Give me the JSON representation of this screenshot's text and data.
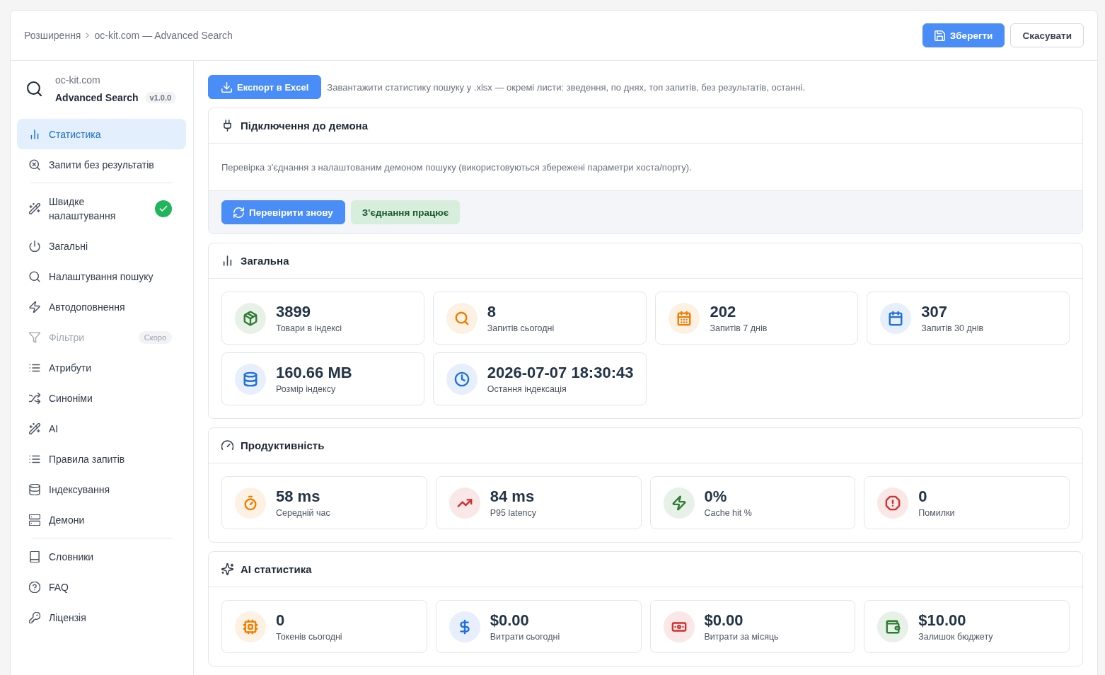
{
  "header": {
    "breadcrumb": [
      "Розширення",
      "oc-kit.com — Advanced Search"
    ],
    "buttons": [
      {
        "label": "Зберегти",
        "kind": "primary"
      },
      {
        "label": "Скасувати",
        "kind": "secondary"
      }
    ]
  },
  "sidebar": {
    "brand": {
      "site": "oc-kit.com",
      "name": "Advanced Search",
      "version": "v1.0.0"
    },
    "groups": [
      {
        "items": [
          {
            "label": "Статистика",
            "selected": true,
            "disabled": false,
            "completed": false
          },
          {
            "label": "Запити без результатів",
            "selected": false,
            "disabled": false,
            "completed": false
          }
        ]
      },
      {
        "items": [
          {
            "label": "Швидке налаштування",
            "selected": false,
            "disabled": false,
            "completed": true
          },
          {
            "label": "Загальні",
            "selected": false,
            "disabled": false,
            "completed": false
          },
          {
            "label": "Налаштування пошуку",
            "selected": false,
            "disabled": false,
            "completed": false
          },
          {
            "label": "Автодоповнення",
            "selected": false,
            "disabled": false,
            "completed": false
          },
          {
            "label": "Фільтри",
            "selected": false,
            "disabled": true,
            "completed": false,
            "badge": "Скоро"
          },
          {
            "label": "Атрибути",
            "selected": false,
            "disabled": false,
            "completed": false
          },
          {
            "label": "Синоніми",
            "selected": false,
            "disabled": false,
            "completed": false
          },
          {
            "label": "AI",
            "selected": false,
            "disabled": false,
            "completed": false
          },
          {
            "label": "Правила запитів",
            "selected": false,
            "disabled": false,
            "completed": false
          },
          {
            "label": "Індексування",
            "selected": false,
            "disabled": false,
            "completed": false
          },
          {
            "label": "Демони",
            "selected": false,
            "disabled": false,
            "completed": false
          }
        ]
      },
      {
        "items": [
          {
            "label": "Словники",
            "selected": false,
            "disabled": false,
            "completed": false
          },
          {
            "label": "FAQ",
            "selected": false,
            "disabled": false,
            "completed": false
          },
          {
            "label": "Ліцензія",
            "selected": false,
            "disabled": false,
            "completed": false
          }
        ]
      }
    ]
  },
  "main": {
    "export": {
      "button": "Експорт в Excel",
      "description": "Завантажити статистику пошуку у .xlsx — окремі листи: зведення, по днях, топ запитів, без результатів, останні."
    },
    "connection": {
      "title": "Підключення до демона",
      "description": "Перевірка з'єднання з налаштованим демоном пошуку (використовуються збережені параметри хоста/порту).",
      "button": "Перевірити знову",
      "status": {
        "label": "З'єднання працює",
        "ok": true
      }
    },
    "sections": [
      {
        "title": "Загальна",
        "stats": [
          {
            "value": "3899",
            "label": "Товари в індексі",
            "color": "#2e7d32"
          },
          {
            "value": "8",
            "label": "Запитів сьогодні",
            "color": "#f07c00"
          },
          {
            "value": "202",
            "label": "Запитів 7 днів",
            "color": "#f07c00"
          },
          {
            "value": "307",
            "label": "Запитів 30 днів",
            "color": "#1e6fd9"
          },
          {
            "value": "160.66 MB",
            "label": "Розмір індексу",
            "color": "#1e6fd9"
          },
          {
            "value": "2026-07-07 18:30:43",
            "label": "Остання індексація",
            "color": "#1e6fd9"
          }
        ]
      },
      {
        "title": "Продуктивність",
        "stats": [
          {
            "value": "58 ms",
            "label": "Середній час",
            "color": "#f07c00"
          },
          {
            "value": "84 ms",
            "label": "P95 latency",
            "color": "#d32f2f"
          },
          {
            "value": "0%",
            "label": "Cache hit %",
            "color": "#2e7d32"
          },
          {
            "value": "0",
            "label": "Помилки",
            "color": "#d32f2f"
          }
        ]
      },
      {
        "title": "AI статистика",
        "stats": [
          {
            "value": "0",
            "label": "Токенів сьогодні",
            "color": "#f07c00"
          },
          {
            "value": "$0.00",
            "label": "Витрати сьогодні",
            "color": "#1e6fd9"
          },
          {
            "value": "$0.00",
            "label": "Витрати за місяць",
            "color": "#d32f2f"
          },
          {
            "value": "$10.00",
            "label": "Залишок бюджету",
            "color": "#2e7d32"
          }
        ]
      }
    ]
  }
}
